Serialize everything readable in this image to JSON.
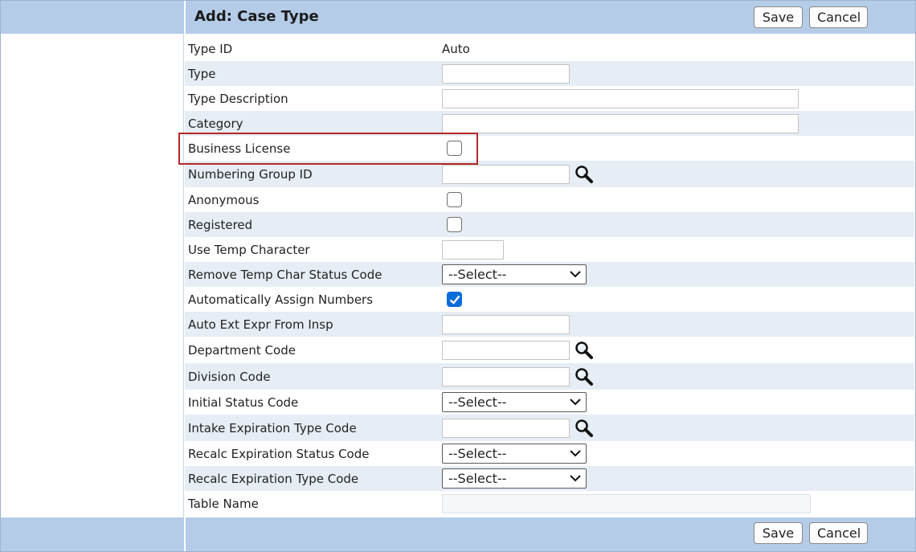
{
  "title": "Add: Case Type",
  "buttons": {
    "save": "Save",
    "cancel": "Cancel"
  },
  "select_placeholder": "--Select--",
  "fields": {
    "type_id": {
      "label": "Type ID",
      "value": "Auto"
    },
    "type": {
      "label": "Type",
      "value": ""
    },
    "type_description": {
      "label": "Type Description",
      "value": ""
    },
    "category": {
      "label": "Category",
      "value": ""
    },
    "business_license": {
      "label": "Business License",
      "checked": false
    },
    "numbering_group_id": {
      "label": "Numbering Group ID",
      "value": ""
    },
    "anonymous": {
      "label": "Anonymous",
      "checked": false
    },
    "registered": {
      "label": "Registered",
      "checked": false
    },
    "use_temp_character": {
      "label": "Use Temp Character",
      "value": ""
    },
    "remove_temp_char_status_code": {
      "label": "Remove Temp Char Status Code",
      "selected": "--Select--"
    },
    "automatically_assign_numbers": {
      "label": "Automatically Assign Numbers",
      "checked": true
    },
    "auto_ext_expr_from_insp": {
      "label": "Auto Ext Expr From Insp",
      "value": ""
    },
    "department_code": {
      "label": "Department Code",
      "value": ""
    },
    "division_code": {
      "label": "Division Code",
      "value": ""
    },
    "initial_status_code": {
      "label": "Initial Status Code",
      "selected": "--Select--"
    },
    "intake_expiration_type_code": {
      "label": "Intake Expiration Type Code",
      "value": ""
    },
    "recalc_expiration_status_code": {
      "label": "Recalc Expiration Status Code",
      "selected": "--Select--"
    },
    "recalc_expiration_type_code": {
      "label": "Recalc Expiration Type Code",
      "selected": "--Select--"
    },
    "table_name": {
      "label": "Table Name",
      "value": ""
    }
  },
  "icons": {
    "lookup": "magnifier-icon",
    "dropdown": "chevron-down-icon",
    "check": "checkmark-icon"
  },
  "colors": {
    "header_bg": "#b4cce8",
    "row_alt_bg": "#e6edf4",
    "highlight": "#b42828",
    "checkbox_checked": "#0a6cda"
  }
}
